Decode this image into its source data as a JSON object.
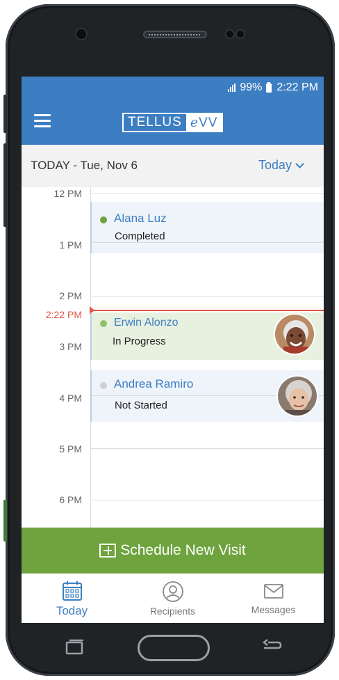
{
  "status_bar": {
    "battery": "99%",
    "time": "2:22 PM"
  },
  "app_bar": {
    "logo_text_left": "TELLUS",
    "logo_text_right_italic": "e",
    "logo_text_right": "VV"
  },
  "date_bar": {
    "title": "TODAY - Tue, Nov 6",
    "dropdown_label": "Today"
  },
  "timeline": {
    "hours": [
      "12 PM",
      "1 PM",
      "2 PM",
      "3 PM",
      "4 PM",
      "5 PM",
      "6 PM"
    ],
    "now_label": "2:22 PM"
  },
  "visits": [
    {
      "name": "Alana Luz",
      "status": "Completed",
      "status_color": "#6ea33d"
    },
    {
      "name": "Erwin Alonzo",
      "status": "In Progress",
      "status_color": "#8cc26a"
    },
    {
      "name": "Andrea Ramiro",
      "status": "Not Started",
      "status_color": "#cfcfcf"
    }
  ],
  "schedule_button": {
    "label": "Schedule New Visit"
  },
  "tabs": [
    {
      "label": "Today",
      "icon": "calendar-icon"
    },
    {
      "label": "Recipients",
      "icon": "person-icon"
    },
    {
      "label": "Messages",
      "icon": "envelope-icon"
    }
  ],
  "colors": {
    "brand_blue": "#3d7ec2",
    "cta_green": "#6ea33d",
    "now_red": "#e25548"
  }
}
